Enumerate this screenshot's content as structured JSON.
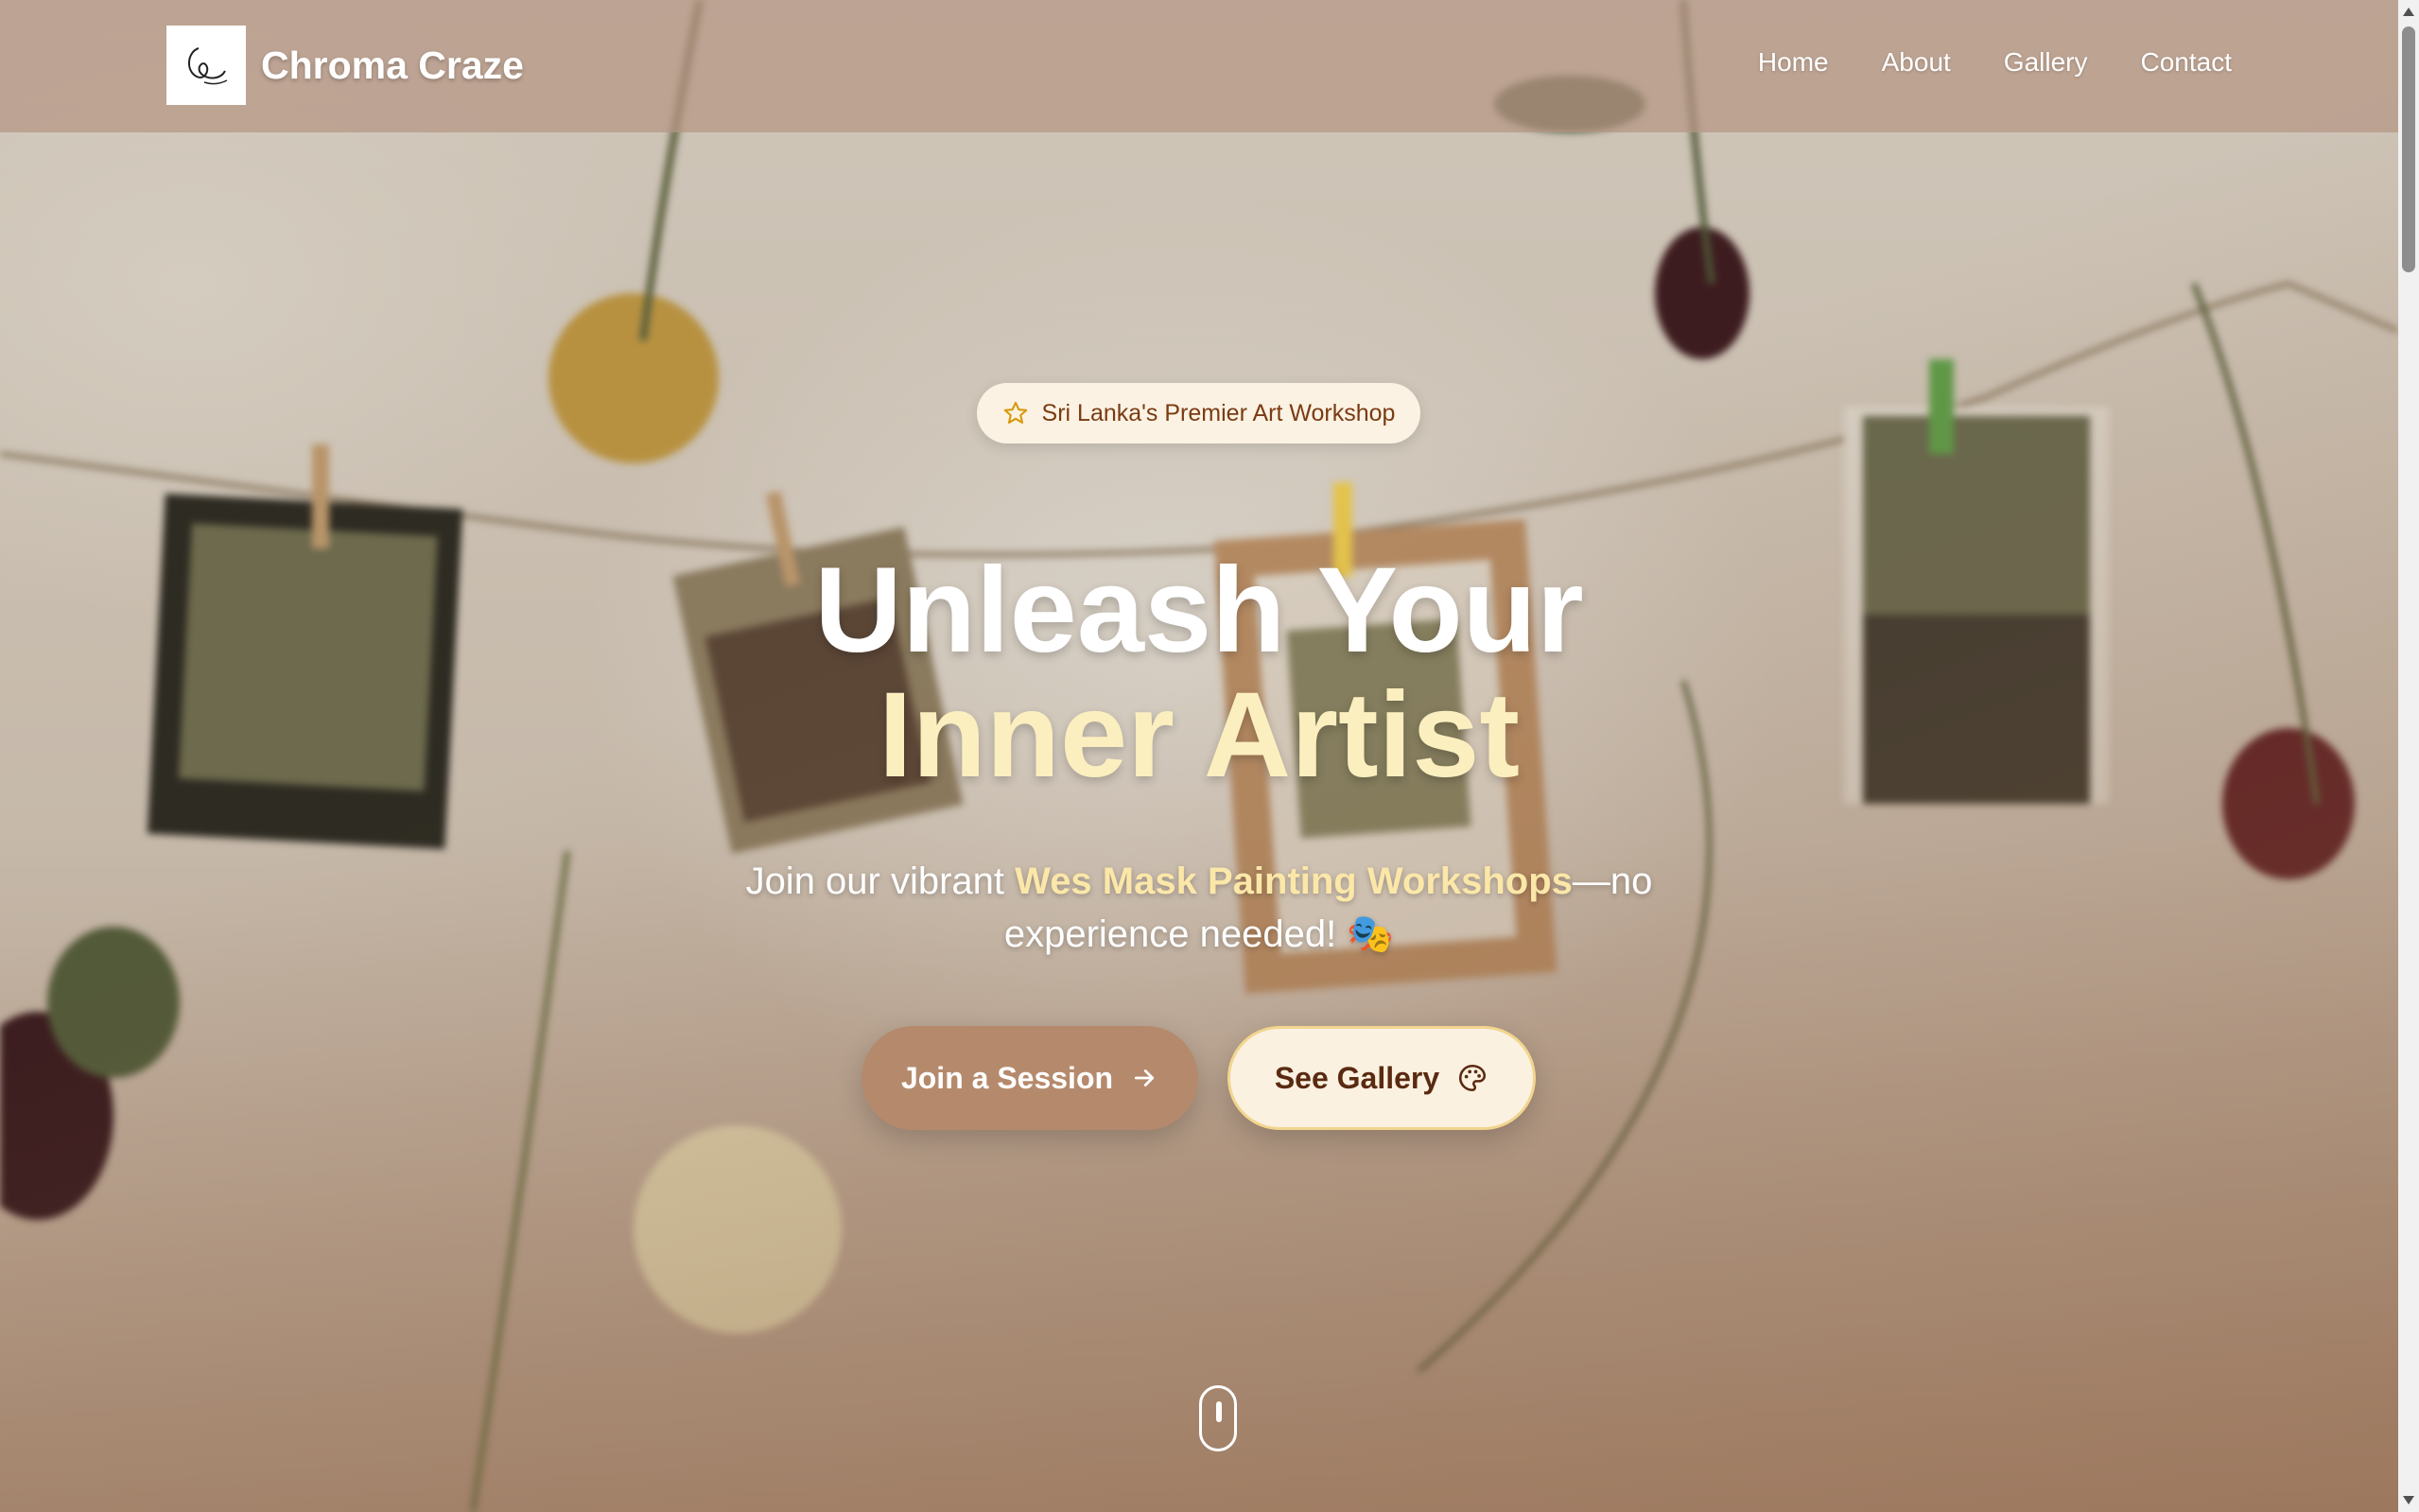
{
  "brand": {
    "name": "Chroma Craze",
    "logo_icon": "signature-logo-icon"
  },
  "nav": {
    "items": [
      {
        "label": "Home"
      },
      {
        "label": "About"
      },
      {
        "label": "Gallery"
      },
      {
        "label": "Contact"
      }
    ]
  },
  "hero": {
    "badge": {
      "icon": "star-icon",
      "text": "Sri Lanka's Premier Art Workshop"
    },
    "headline_line1": "Unleash Your",
    "headline_line2": "Inner Artist",
    "subtext_before": "Join our vibrant ",
    "subtext_highlight": "Wes Mask Painting Workshops",
    "subtext_after": "—no experience needed! 🎭",
    "primary_button": {
      "label": "Join a Session",
      "icon": "arrow-right-icon"
    },
    "secondary_button": {
      "label": "See Gallery",
      "icon": "palette-icon"
    },
    "scroll_indicator_icon": "mouse-scroll-icon"
  },
  "colors": {
    "navbar_bg": "#b69683",
    "headline_accent": "#fbefbf",
    "highlight_text": "#fbe7a8",
    "primary_button_bg": "#b58a6c",
    "secondary_button_bg": "#fbf1e1",
    "secondary_button_border": "#f2d58e",
    "badge_text": "#7a3b12"
  }
}
